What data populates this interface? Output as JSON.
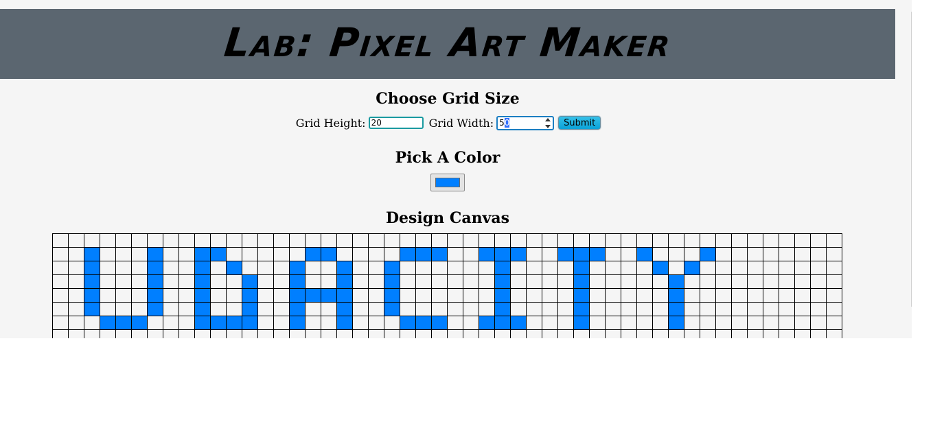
{
  "header": {
    "title": "Lab: Pixel Art Maker"
  },
  "grid_size": {
    "heading": "Choose Grid Size",
    "height_label": "Grid Height:",
    "height_value": "20",
    "width_label": "Grid Width:",
    "width_value": "50",
    "submit_label": "Submit"
  },
  "color": {
    "heading": "Pick A Color",
    "selected_color": "#007fff"
  },
  "canvas": {
    "heading": "Design Canvas",
    "grid_height": 20,
    "grid_width": 50,
    "visible_rows": 8,
    "fill_color": "#007fff",
    "filled_cells": [
      [
        1,
        2
      ],
      [
        1,
        6
      ],
      [
        1,
        9
      ],
      [
        1,
        10
      ],
      [
        1,
        16
      ],
      [
        1,
        17
      ],
      [
        1,
        22
      ],
      [
        1,
        23
      ],
      [
        1,
        24
      ],
      [
        1,
        27
      ],
      [
        1,
        28
      ],
      [
        1,
        29
      ],
      [
        1,
        32
      ],
      [
        1,
        33
      ],
      [
        1,
        34
      ],
      [
        1,
        37
      ],
      [
        1,
        41
      ],
      [
        2,
        2
      ],
      [
        2,
        6
      ],
      [
        2,
        9
      ],
      [
        2,
        11
      ],
      [
        2,
        15
      ],
      [
        2,
        18
      ],
      [
        2,
        21
      ],
      [
        2,
        28
      ],
      [
        2,
        33
      ],
      [
        2,
        38
      ],
      [
        2,
        40
      ],
      [
        3,
        2
      ],
      [
        3,
        6
      ],
      [
        3,
        9
      ],
      [
        3,
        12
      ],
      [
        3,
        15
      ],
      [
        3,
        18
      ],
      [
        3,
        21
      ],
      [
        3,
        28
      ],
      [
        3,
        33
      ],
      [
        3,
        39
      ],
      [
        4,
        2
      ],
      [
        4,
        6
      ],
      [
        4,
        9
      ],
      [
        4,
        12
      ],
      [
        4,
        15
      ],
      [
        4,
        16
      ],
      [
        4,
        17
      ],
      [
        4,
        18
      ],
      [
        4,
        21
      ],
      [
        4,
        28
      ],
      [
        4,
        33
      ],
      [
        4,
        39
      ],
      [
        5,
        2
      ],
      [
        5,
        6
      ],
      [
        5,
        9
      ],
      [
        5,
        12
      ],
      [
        5,
        15
      ],
      [
        5,
        18
      ],
      [
        5,
        21
      ],
      [
        5,
        28
      ],
      [
        5,
        33
      ],
      [
        5,
        39
      ],
      [
        6,
        3
      ],
      [
        6,
        4
      ],
      [
        6,
        5
      ],
      [
        6,
        9
      ],
      [
        6,
        10
      ],
      [
        6,
        11
      ],
      [
        6,
        12
      ],
      [
        6,
        15
      ],
      [
        6,
        18
      ],
      [
        6,
        22
      ],
      [
        6,
        23
      ],
      [
        6,
        24
      ],
      [
        6,
        27
      ],
      [
        6,
        28
      ],
      [
        6,
        29
      ],
      [
        6,
        33
      ],
      [
        6,
        39
      ]
    ]
  }
}
